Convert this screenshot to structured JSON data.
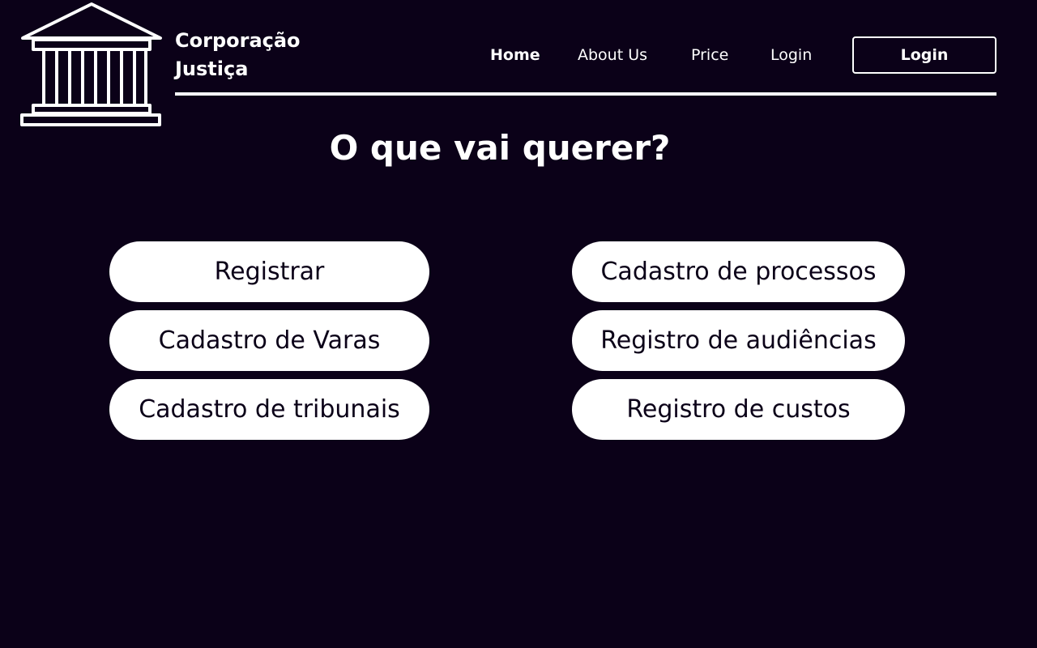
{
  "brand": {
    "logo_icon": "courthouse-icon",
    "name_line1": "Corporação",
    "name_line2": "Justiça"
  },
  "nav": {
    "items": [
      {
        "label": "Home",
        "active": true
      },
      {
        "label": "About Us",
        "active": false
      },
      {
        "label": "Price",
        "active": false
      },
      {
        "label": "Login",
        "active": false
      }
    ],
    "login_button_label": "Login"
  },
  "main": {
    "title": "O que vai querer?",
    "options_left": [
      {
        "label": "Registrar"
      },
      {
        "label": "Cadastro de Varas"
      },
      {
        "label": "Cadastro de tribunais"
      }
    ],
    "options_right": [
      {
        "label": "Cadastro de processos"
      },
      {
        "label": "Registro de audiências"
      },
      {
        "label": "Registro de custos"
      }
    ]
  },
  "colors": {
    "background": "#0b0118",
    "foreground": "#ffffff",
    "button_text": "#0b0118"
  }
}
